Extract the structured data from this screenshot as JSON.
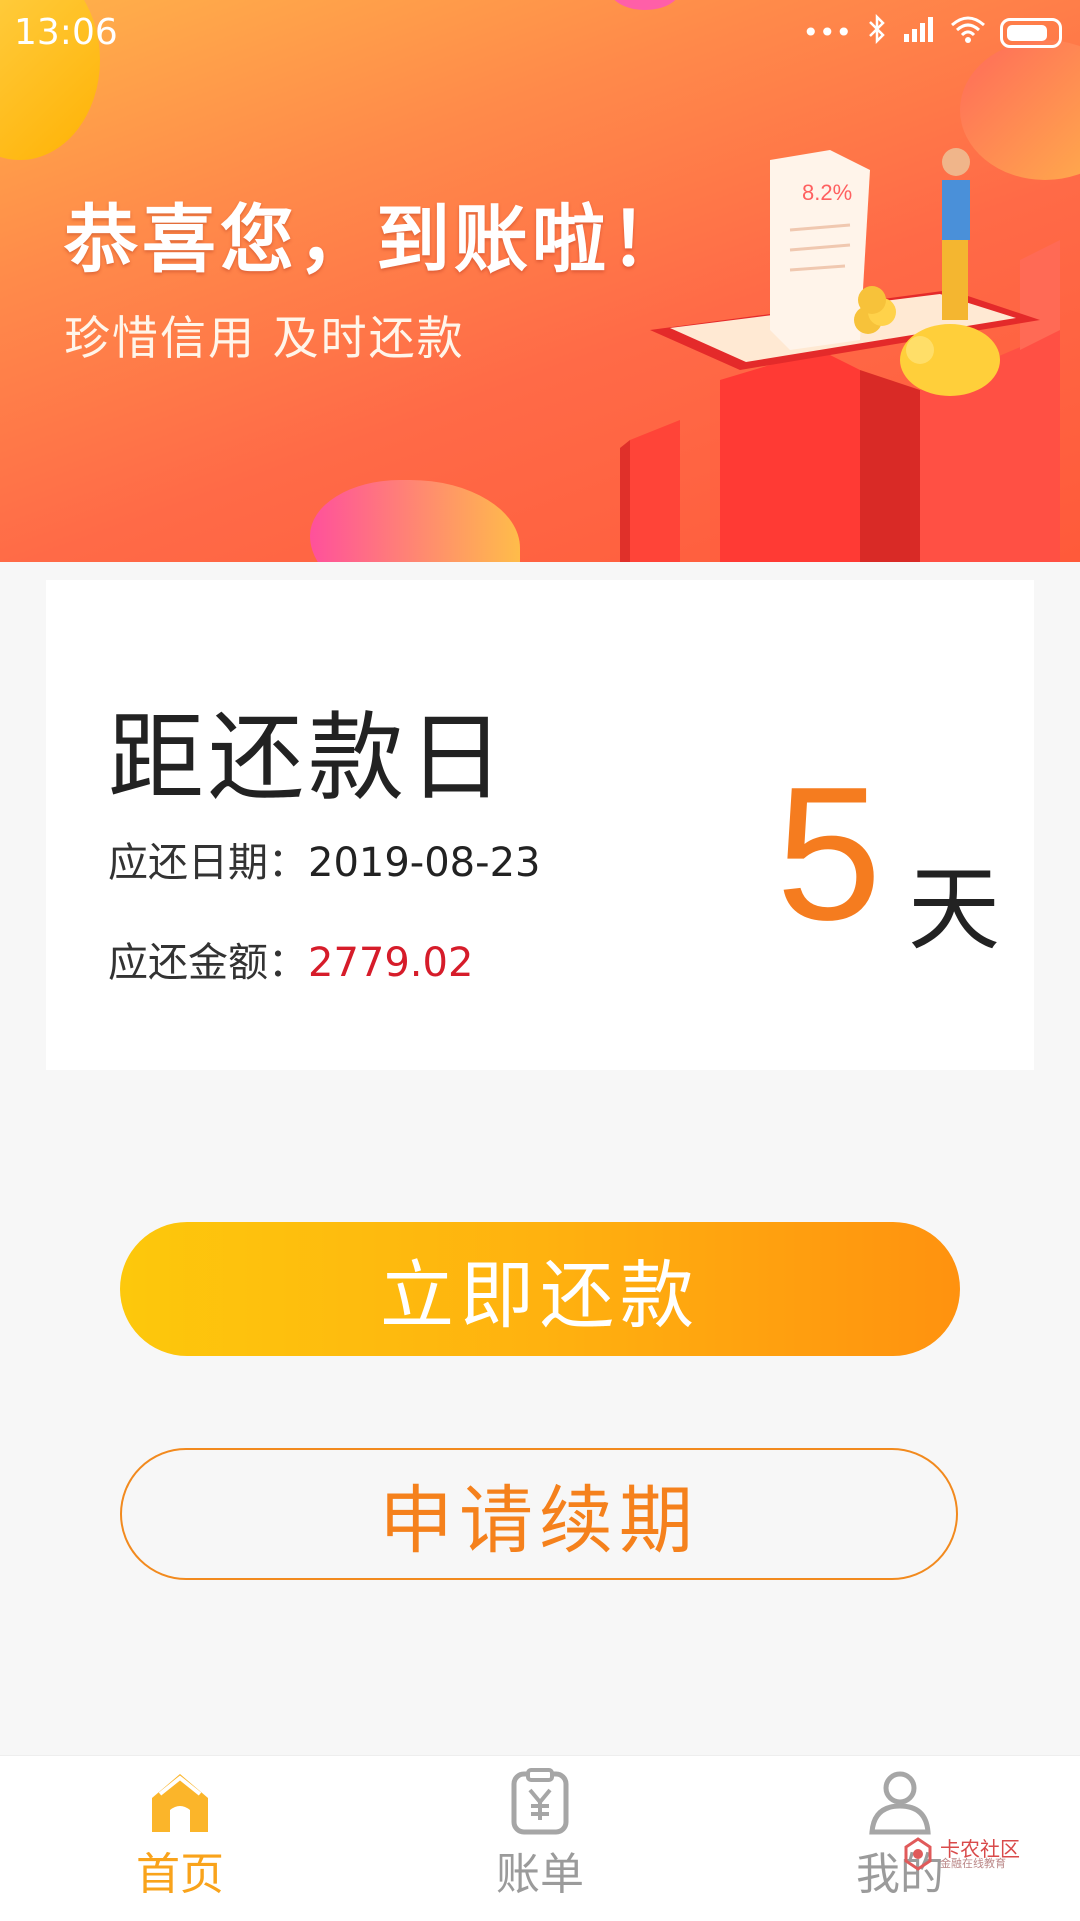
{
  "status_bar": {
    "time": "13:06",
    "dots": "•••"
  },
  "banner": {
    "headline": "恭喜您，到账啦！",
    "subline": "珍惜信用 及时还款",
    "receipt_text": "8.2%"
  },
  "card": {
    "title": "距还款日",
    "due_date_label": "应还日期：",
    "due_date_value": "2019-08-23",
    "amount_label": "应还金额：",
    "amount_value": "2779.02",
    "days_value": "5",
    "days_unit": "天"
  },
  "buttons": {
    "repay": "立即还款",
    "extend": "申请续期"
  },
  "tabs": [
    {
      "label": "首页",
      "icon": "home-icon",
      "active": true
    },
    {
      "label": "账单",
      "icon": "bill-icon",
      "active": false
    },
    {
      "label": "我的",
      "icon": "user-icon",
      "active": false
    }
  ],
  "watermark": {
    "title": "卡农社区",
    "subtitle": "金融在线教育"
  },
  "colors": {
    "accent": "#f57c1f",
    "amount_red": "#d61c2a",
    "tab_active": "#f9a31b",
    "tab_inactive": "#9b9b9b"
  }
}
